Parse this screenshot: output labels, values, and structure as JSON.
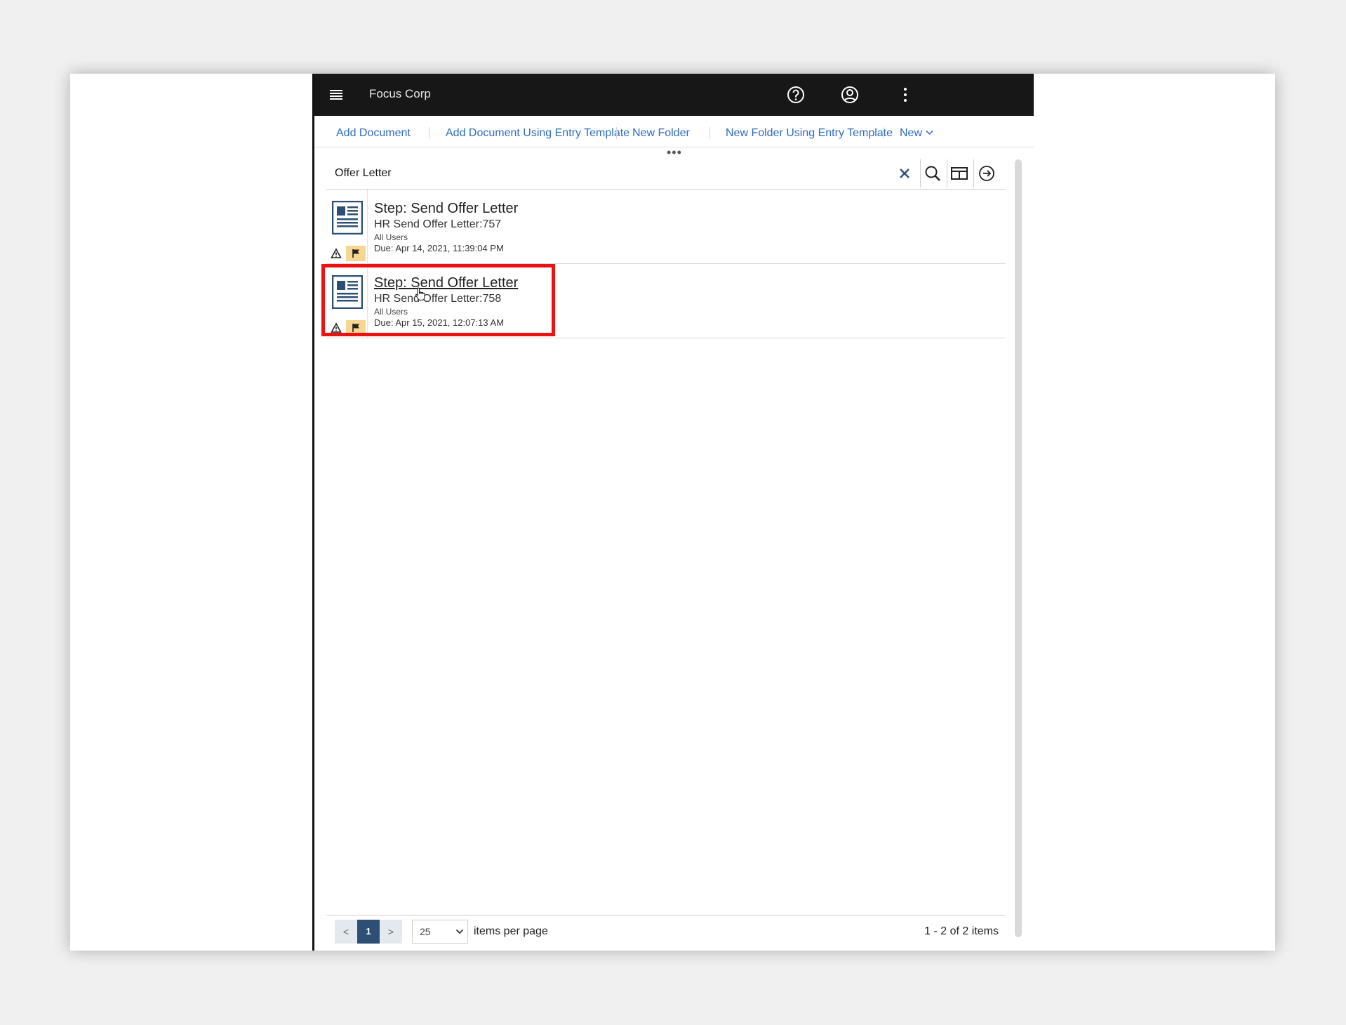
{
  "header": {
    "brand": "Focus Corp",
    "icons": [
      "menu-icon",
      "help-icon",
      "user-icon",
      "overflow-menu-icon"
    ]
  },
  "toolbar": {
    "add_document": "Add Document",
    "add_document_template": "Add Document Using Entry Template",
    "new_folder": "New Folder",
    "new_folder_template": "New Folder Using Entry Template",
    "new": "New",
    "more": "•••"
  },
  "search": {
    "value": "Offer Letter",
    "icons": [
      "close-icon",
      "search-icon",
      "table-view-icon",
      "arrow-right-circle-icon"
    ]
  },
  "results": {
    "items": [
      {
        "title": "Step: Send Offer Letter",
        "subtitle": "HR Send Offer Letter:757",
        "assignee": "All Users",
        "due": "Due: Apr 14, 2021, 11:39:04 PM"
      },
      {
        "title": "Step: Send Offer Letter",
        "subtitle": "HR Send Offer Letter:758",
        "assignee": "All Users",
        "due": "Due: Apr 15, 2021, 12:07:13 AM"
      }
    ]
  },
  "pagination": {
    "prev": "<",
    "current": "1",
    "next": ">",
    "per_page_value": "25",
    "per_page_label": "items per page",
    "summary": "1 - 2 of 2 items"
  },
  "colors": {
    "link": "#2d6cc0",
    "topbar": "#171717",
    "highlight": "#ee1111",
    "flag_bg": "#f6d690",
    "doc_icon": "#2d4f73"
  }
}
